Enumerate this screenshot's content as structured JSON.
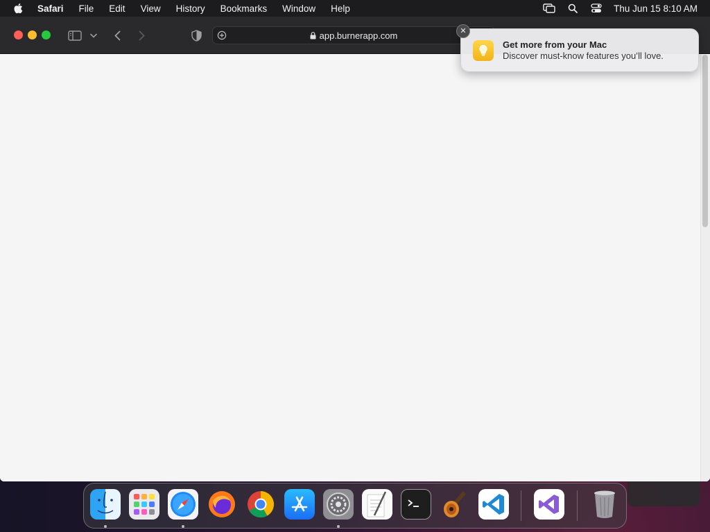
{
  "menubar": {
    "app_name": "Safari",
    "items": [
      "File",
      "Edit",
      "View",
      "History",
      "Bookmarks",
      "Window",
      "Help"
    ],
    "clock": "Thu Jun 15  8:10 AM"
  },
  "browser": {
    "url": "app.burnerapp.com"
  },
  "notification": {
    "title": "Get more from your Mac",
    "body": "Discover must-know features you’ll love."
  },
  "dock": {
    "apps": [
      "Finder",
      "Launchpad",
      "Safari",
      "Firefox",
      "Chrome",
      "App Store",
      "System Settings",
      "TextEdit",
      "Terminal",
      "GarageBand",
      "Visual Studio Code",
      "Visual Studio",
      "Trash"
    ]
  },
  "colors": {
    "close": "#fe5f57",
    "minimize": "#febc2e",
    "maximize": "#28c840"
  }
}
